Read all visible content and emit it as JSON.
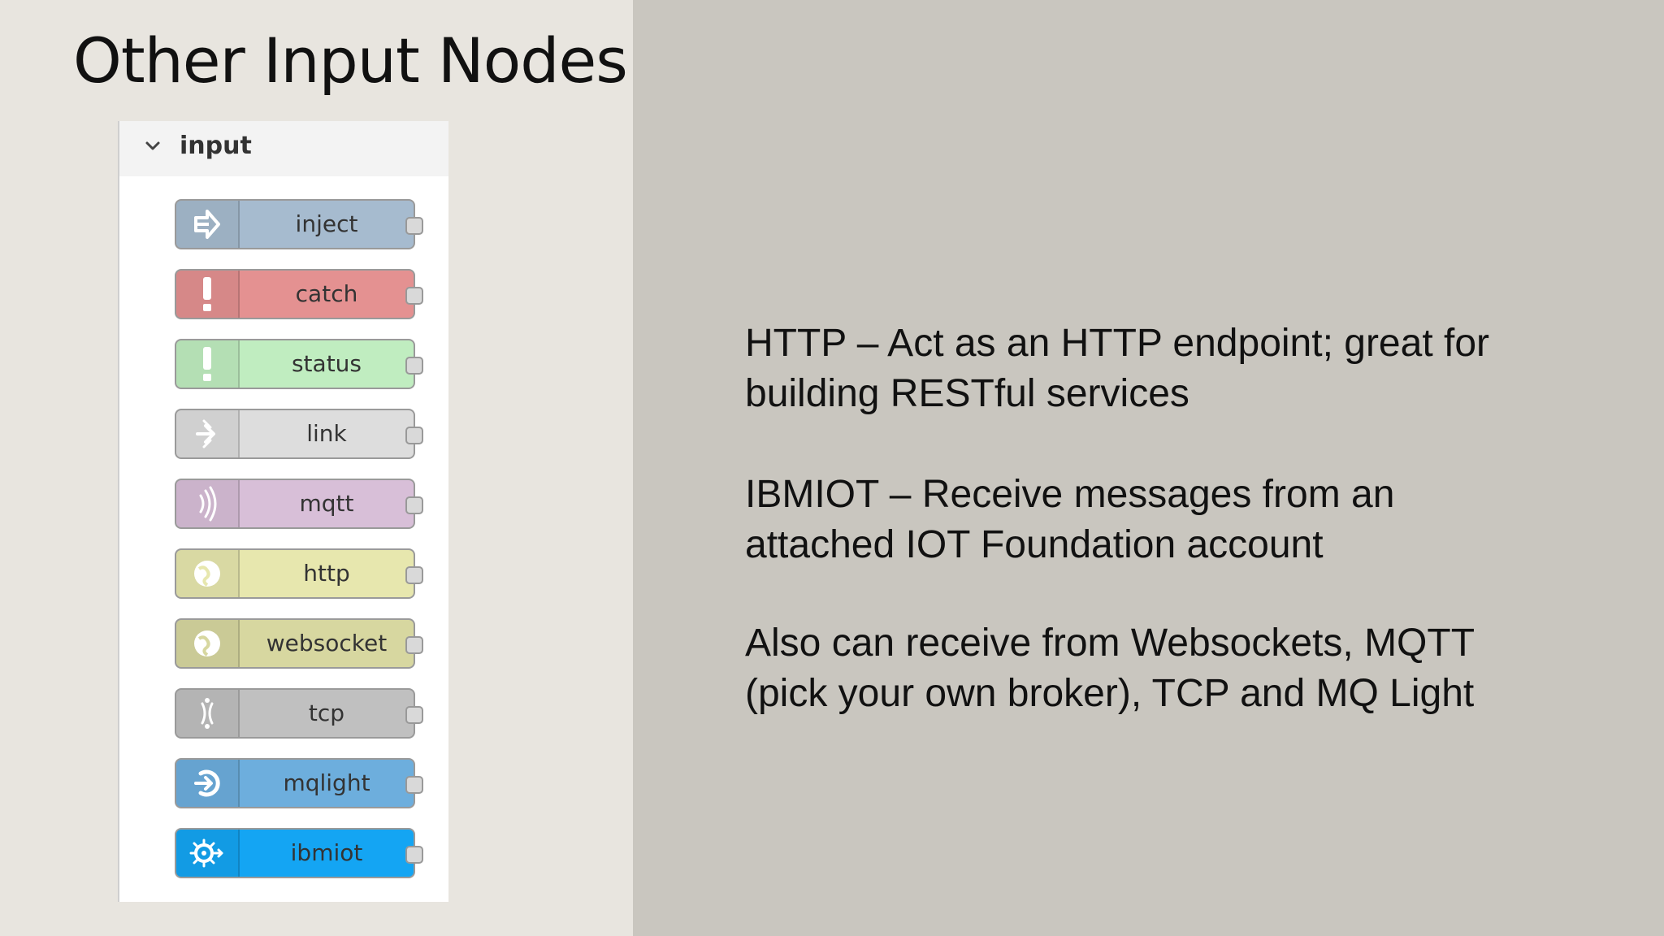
{
  "slide": {
    "title": "Other Input Nodes"
  },
  "palette": {
    "category": "input",
    "nodes": [
      {
        "label": "inject",
        "color": "#a6bbcf",
        "icon": "inject-arrow-icon"
      },
      {
        "label": "catch",
        "color": "#e49191",
        "icon": "exclamation-icon"
      },
      {
        "label": "status",
        "color": "#c0edc0",
        "icon": "exclamation-icon"
      },
      {
        "label": "link",
        "color": "#dddddd",
        "icon": "link-arrow-icon"
      },
      {
        "label": "mqtt",
        "color": "#d8bfd8",
        "icon": "radio-waves-icon"
      },
      {
        "label": "http",
        "color": "#e7e7ae",
        "icon": "globe-icon"
      },
      {
        "label": "websocket",
        "color": "#d7d7a0",
        "icon": "globe-icon"
      },
      {
        "label": "tcp",
        "color": "#c0c0c0",
        "icon": "bridge-icon"
      },
      {
        "label": "mqlight",
        "color": "#6daedd",
        "icon": "mqlight-arrow-icon"
      },
      {
        "label": "ibmiot",
        "color": "#14a5f3",
        "icon": "gear-chip-icon"
      }
    ]
  },
  "descriptions": [
    {
      "line1": "HTTP – Act as an HTTP endpoint; great for",
      "line2": "building RESTful services"
    },
    {
      "line1": "IBMIOT – Receive messages from an",
      "line2": "attached IOT Foundation account"
    },
    {
      "line1": "Also can receive from Websockets, MQTT",
      "line2": "(pick your own broker), TCP and MQ Light"
    }
  ]
}
